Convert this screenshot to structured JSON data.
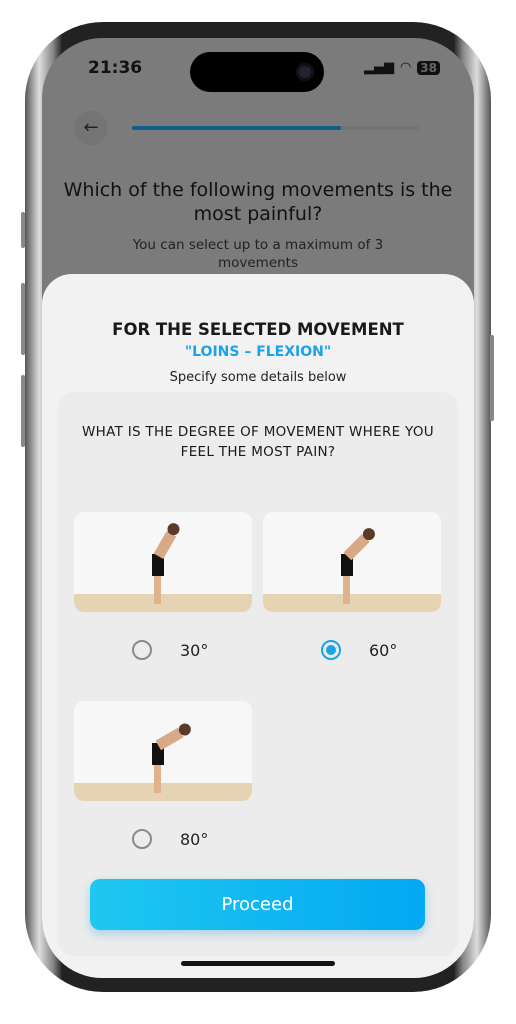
{
  "status": {
    "time": "21:36",
    "battery": "38"
  },
  "header": {
    "back_icon": "arrow-left-icon",
    "progress_percent": 73
  },
  "question": {
    "title": "Which of the following movements is the most painful?",
    "subtitle": "You can select up to a maximum of 3 movements"
  },
  "sheet": {
    "title": "FOR THE SELECTED MOVEMENT",
    "movement": "\"LOINS – FLEXION\"",
    "instruction": "Specify some details below",
    "card_question": "WHAT IS THE DEGREE OF MOVEMENT WHERE YOU FEEL THE MOST PAIN?",
    "options": [
      {
        "label": "30°",
        "selected": false
      },
      {
        "label": "60°",
        "selected": true
      },
      {
        "label": "80°",
        "selected": false
      }
    ],
    "proceed_label": "Proceed"
  },
  "colors": {
    "accent": "#1aa3e8",
    "button_start": "#1ec8f0",
    "button_end": "#03a8f2",
    "progress": "#0b5f8a"
  }
}
